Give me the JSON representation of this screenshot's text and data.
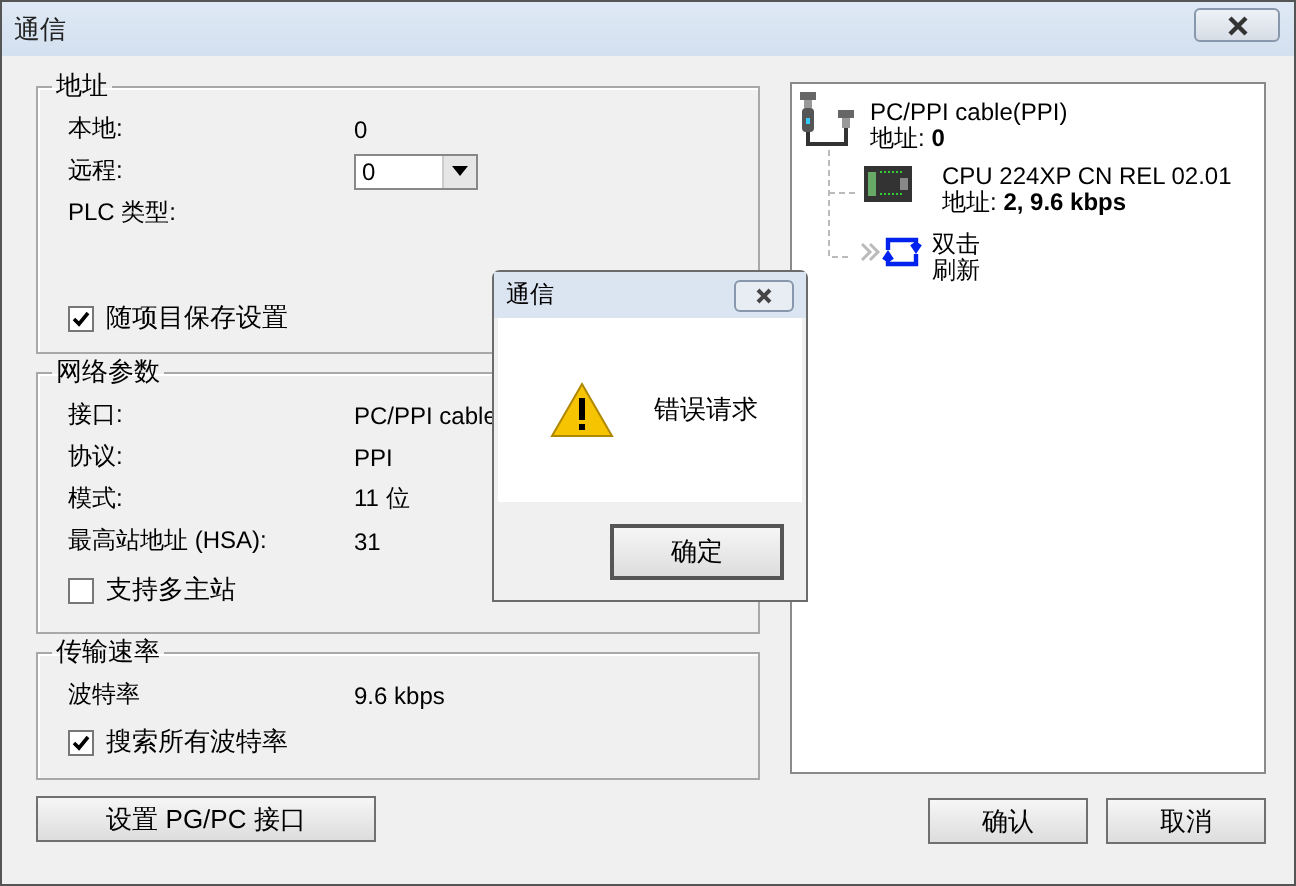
{
  "window": {
    "title": "通信"
  },
  "address": {
    "title": "地址",
    "rows": [
      {
        "kind": "text",
        "label": "本地:",
        "value": "0"
      },
      {
        "kind": "select",
        "label": "远程:",
        "value": "0"
      },
      {
        "kind": "text",
        "label": "PLC 类型:"
      }
    ],
    "save_settings": {
      "label": "随项目保存设置",
      "checked": true
    }
  },
  "network": {
    "title": "网络参数",
    "rows": [
      {
        "label": "接口:",
        "value": "PC/PPI cable"
      },
      {
        "label": "协议:",
        "value": "PPI"
      },
      {
        "label": "模式:",
        "value": "11 位"
      },
      {
        "label": "最高站地址 (HSA):",
        "value": "31"
      }
    ],
    "multi_master": {
      "label": "支持多主站",
      "checked": false
    }
  },
  "speed": {
    "title": "传输速率",
    "rows": [
      {
        "label": "波特率",
        "value": "9.6 kbps"
      }
    ],
    "search_all": {
      "label": "搜索所有波特率",
      "checked": true
    }
  },
  "setup_button": "设置 PG/PC 接口",
  "tree": [
    {
      "kind": "cable",
      "name": "PC/PPI cable(PPI)",
      "address_label": "地址:",
      "address": "0"
    },
    {
      "kind": "cpu",
      "name": "CPU 224XP CN REL 02.01",
      "address_label": "地址:",
      "address": "2, 9.6 kbps"
    },
    {
      "kind": "refresh",
      "lines": [
        "双击",
        "刷新"
      ]
    }
  ],
  "buttons": [
    "确认",
    "取消"
  ],
  "message_box": {
    "title": "通信",
    "message": "错误请求",
    "button": "确定"
  }
}
